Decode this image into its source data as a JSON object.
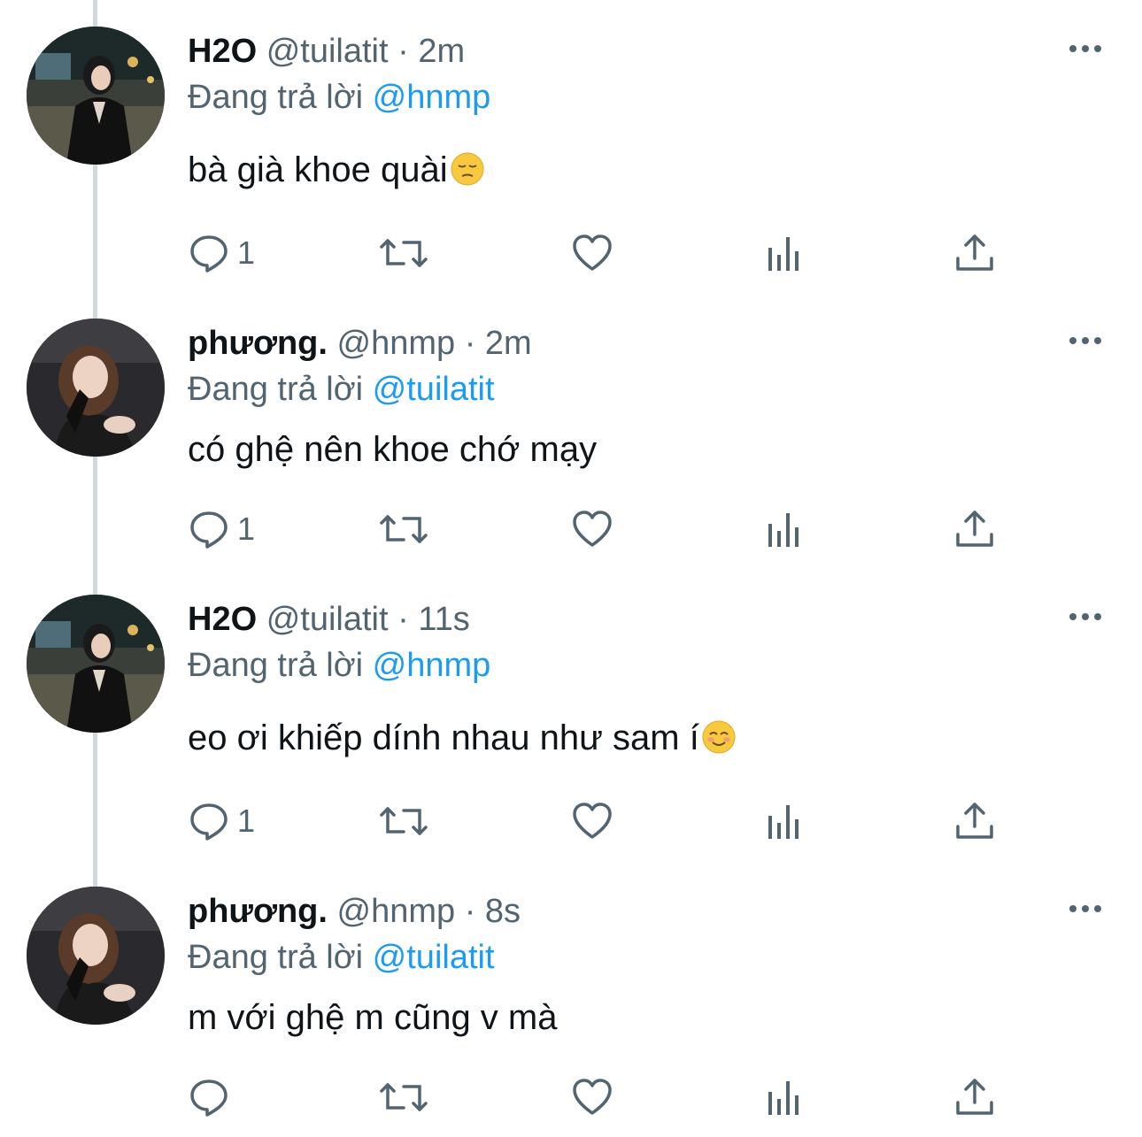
{
  "theme": {
    "text": "#0f1419",
    "secondary": "#536471",
    "link": "#1d9bf0",
    "thread_line": "#cfd9de"
  },
  "replying_prefix": "Đang trả lời",
  "tweets": [
    {
      "name": "H2O",
      "handle": "@tuilatit",
      "dot": "·",
      "time": "2m",
      "reply_to": "@hnmp",
      "text": "bà già khoe quài",
      "emoji": "pensive-face-emoji",
      "reply_count": "1",
      "avatar": "avatar-h2o"
    },
    {
      "name": "phương.",
      "handle": "@hnmp",
      "dot": "·",
      "time": "2m",
      "reply_to": "@tuilatit",
      "text": "có ghệ nên khoe chớ mạy",
      "emoji": "",
      "reply_count": "1",
      "avatar": "avatar-phuong"
    },
    {
      "name": "H2O",
      "handle": "@tuilatit",
      "dot": "·",
      "time": "11s",
      "reply_to": "@hnmp",
      "text": "eo ơi khiếp dính nhau như sam í",
      "emoji": "smiling-face-emoji",
      "reply_count": "1",
      "avatar": "avatar-h2o"
    },
    {
      "name": "phương.",
      "handle": "@hnmp",
      "dot": "·",
      "time": "8s",
      "reply_to": "@tuilatit",
      "text": "m với ghệ m cũng v mà",
      "emoji": "",
      "reply_count": "",
      "avatar": "avatar-phuong"
    }
  ]
}
